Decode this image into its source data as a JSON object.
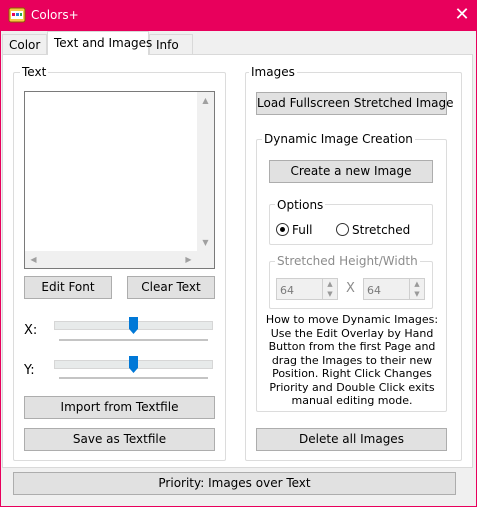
{
  "window": {
    "title": "Colors+",
    "close_glyph": "✕",
    "accent": "#e8005c"
  },
  "tabs": [
    "Color",
    "Text and Images",
    "Info"
  ],
  "text_group": {
    "legend": "Text",
    "edit_font": "Edit Font",
    "clear_text": "Clear Text",
    "x_label": "X:",
    "y_label": "Y:",
    "x_slider_position": 0.5,
    "y_slider_position": 0.5,
    "import": "Import from Textfile",
    "save": "Save as Textfile"
  },
  "images_group": {
    "legend": "Images",
    "load_fullscreen": "Load Fullscreen Stretched Image",
    "dynamic": {
      "legend": "Dynamic Image Creation",
      "create": "Create a new Image",
      "options_legend": "Options",
      "option_full": "Full",
      "option_stretched": "Stretched",
      "selected_option": "Full",
      "stretched_legend": "Stretched Height/Width",
      "height_value": "64",
      "times": "X",
      "width_value": "64",
      "info": "How to move Dynamic Images: Use the Edit Overlay by Hand Button from the first Page and drag the Images to their new Position. Right Click Changes Priority and Double Click exits manual editing mode."
    },
    "delete_all": "Delete all Images"
  },
  "priority_button": "Priority: Images over Text"
}
